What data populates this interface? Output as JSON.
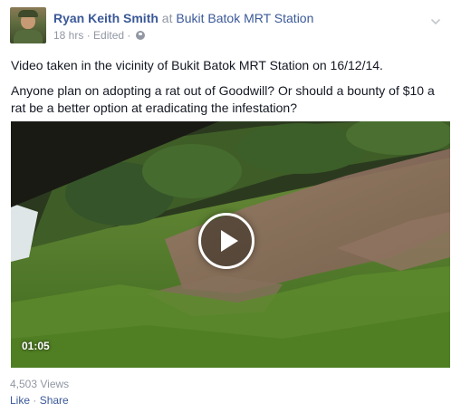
{
  "post": {
    "author": "Ryan Keith Smith",
    "at_word": "at",
    "place": "Bukit Batok MRT Station",
    "time": "18 hrs",
    "separator": "·",
    "edited": "Edited",
    "privacy_icon": "globe-icon",
    "menu_icon": "chevron-down-icon",
    "paragraphs": [
      "Video taken in the vicinity of Bukit Batok MRT Station on 16/12/14.",
      "Anyone plan on adopting a rat out of Goodwill? Or should a bounty of $10 a rat be a better option at eradicating the infestation?"
    ]
  },
  "video": {
    "duration": "01:05",
    "play_icon": "play-icon"
  },
  "footer": {
    "views": "4,503 Views",
    "like": "Like",
    "separator": "·",
    "share": "Share"
  },
  "colors": {
    "link": "#3b5998",
    "muted": "#9197a3",
    "text": "#141823"
  }
}
